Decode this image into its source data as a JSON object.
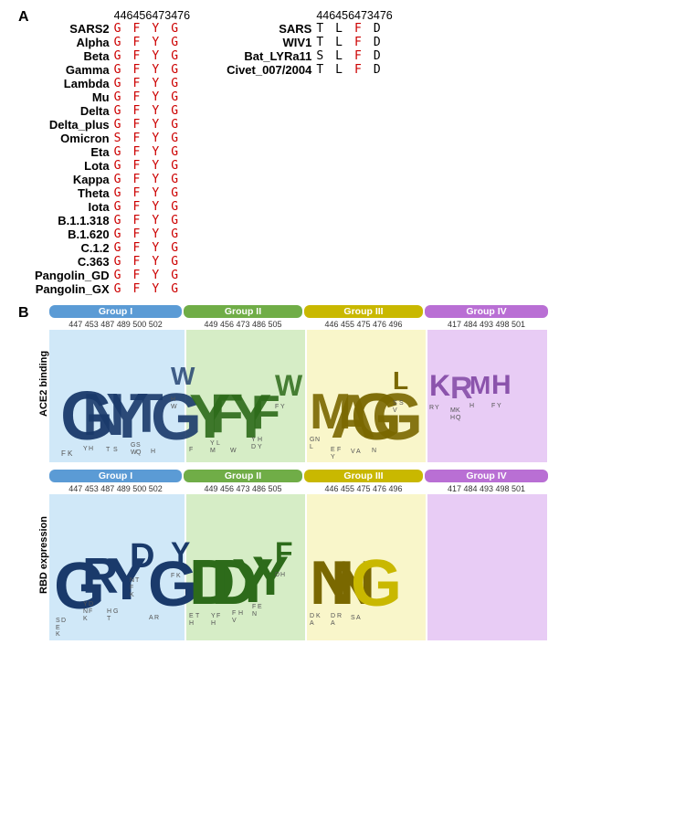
{
  "panel_a_label": "A",
  "panel_b_label": "B",
  "panel_a_left": {
    "col_headers": [
      "446",
      "456",
      "473",
      "476"
    ],
    "rows": [
      {
        "label": "SARS2",
        "vals": [
          "G",
          "F",
          "Y",
          "G"
        ],
        "colors": [
          "red",
          "red",
          "red",
          "red"
        ]
      },
      {
        "label": "Alpha",
        "vals": [
          "G",
          "F",
          "Y",
          "G"
        ],
        "colors": [
          "red",
          "red",
          "red",
          "red"
        ]
      },
      {
        "label": "Beta",
        "vals": [
          "G",
          "F",
          "Y",
          "G"
        ],
        "colors": [
          "red",
          "red",
          "red",
          "red"
        ]
      },
      {
        "label": "Gamma",
        "vals": [
          "G",
          "F",
          "Y",
          "G"
        ],
        "colors": [
          "red",
          "red",
          "red",
          "red"
        ]
      },
      {
        "label": "Lambda",
        "vals": [
          "G",
          "F",
          "Y",
          "G"
        ],
        "colors": [
          "red",
          "red",
          "red",
          "red"
        ]
      },
      {
        "label": "Mu",
        "vals": [
          "G",
          "F",
          "Y",
          "G"
        ],
        "colors": [
          "red",
          "red",
          "red",
          "red"
        ]
      },
      {
        "label": "Delta",
        "vals": [
          "G",
          "F",
          "Y",
          "G"
        ],
        "colors": [
          "red",
          "red",
          "red",
          "red"
        ]
      },
      {
        "label": "Delta_plus",
        "vals": [
          "G",
          "F",
          "Y",
          "G"
        ],
        "colors": [
          "red",
          "red",
          "red",
          "red"
        ]
      },
      {
        "label": "Omicron",
        "vals": [
          "S",
          "F",
          "Y",
          "G"
        ],
        "colors": [
          "red",
          "red",
          "red",
          "red"
        ]
      },
      {
        "label": "Eta",
        "vals": [
          "G",
          "F",
          "Y",
          "G"
        ],
        "colors": [
          "red",
          "red",
          "red",
          "red"
        ]
      },
      {
        "label": "Lota",
        "vals": [
          "G",
          "F",
          "Y",
          "G"
        ],
        "colors": [
          "red",
          "red",
          "red",
          "red"
        ]
      },
      {
        "label": "Kappa",
        "vals": [
          "G",
          "F",
          "Y",
          "G"
        ],
        "colors": [
          "red",
          "red",
          "red",
          "red"
        ]
      },
      {
        "label": "Theta",
        "vals": [
          "G",
          "F",
          "Y",
          "G"
        ],
        "colors": [
          "red",
          "red",
          "red",
          "red"
        ]
      },
      {
        "label": "Iota",
        "vals": [
          "G",
          "F",
          "Y",
          "G"
        ],
        "colors": [
          "red",
          "red",
          "red",
          "red"
        ]
      },
      {
        "label": "B.1.1.318",
        "vals": [
          "G",
          "F",
          "Y",
          "G"
        ],
        "colors": [
          "red",
          "red",
          "red",
          "red"
        ]
      },
      {
        "label": "B.1.620",
        "vals": [
          "G",
          "F",
          "Y",
          "G"
        ],
        "colors": [
          "red",
          "red",
          "red",
          "red"
        ]
      },
      {
        "label": "C.1.2",
        "vals": [
          "G",
          "F",
          "Y",
          "G"
        ],
        "colors": [
          "red",
          "red",
          "red",
          "red"
        ]
      },
      {
        "label": "C.363",
        "vals": [
          "G",
          "F",
          "Y",
          "G"
        ],
        "colors": [
          "red",
          "red",
          "red",
          "red"
        ]
      },
      {
        "label": "Pangolin_GD",
        "vals": [
          "G",
          "F",
          "Y",
          "G"
        ],
        "colors": [
          "red",
          "red",
          "red",
          "red"
        ]
      },
      {
        "label": "Pangolin_GX",
        "vals": [
          "G",
          "F",
          "Y",
          "G"
        ],
        "colors": [
          "red",
          "red",
          "red",
          "red"
        ]
      }
    ]
  },
  "panel_a_right": {
    "col_headers": [
      "446",
      "456",
      "473",
      "476"
    ],
    "rows": [
      {
        "label": "SARS",
        "vals": [
          "T",
          "L",
          "F",
          "D"
        ],
        "colors": [
          "black",
          "black",
          "red",
          "black"
        ]
      },
      {
        "label": "WIV1",
        "vals": [
          "T",
          "L",
          "F",
          "D"
        ],
        "colors": [
          "black",
          "black",
          "red",
          "black"
        ]
      },
      {
        "label": "Bat_LYRa11",
        "vals": [
          "S",
          "L",
          "F",
          "D"
        ],
        "colors": [
          "black",
          "black",
          "red",
          "black"
        ]
      },
      {
        "label": "Civet_007/2004",
        "vals": [
          "T",
          "L",
          "F",
          "D"
        ],
        "colors": [
          "black",
          "black",
          "red",
          "black"
        ]
      }
    ]
  },
  "panel_b": {
    "ace2_ylabel": "ACE2 binding",
    "rbd_ylabel": "RBD expression",
    "groups": [
      {
        "name": "Group I",
        "color": "#5b9bd5",
        "positions_ace2": "447 453 487 489 500 502",
        "positions_rbd": "447 453 487 489 500 502"
      },
      {
        "name": "Group II",
        "color": "#70ad47",
        "positions_ace2": "449 456 473 486 505",
        "positions_rbd": "449 456 473 486 505"
      },
      {
        "name": "Group III",
        "color": "#c9b800",
        "positions_ace2": "446 455 475 476 496",
        "positions_rbd": "446 455 475 476 496"
      },
      {
        "name": "Group IV",
        "color": "#b96fd4",
        "positions_ace2": "417 484 493 498 501",
        "positions_rbd": "417 484 493 498 501"
      }
    ]
  }
}
